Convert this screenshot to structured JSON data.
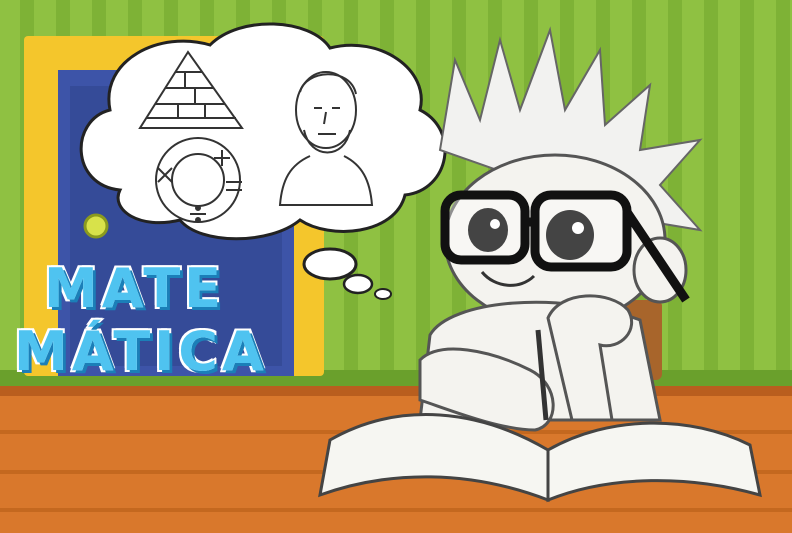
{
  "title": {
    "line1": "MATE",
    "line2": "MÁTICA"
  },
  "thought_bubble": {
    "items": [
      "pyramid-sketch",
      "math-symbols-circle",
      "bust-of-philosopher"
    ]
  },
  "colors": {
    "wall_green": "#8fc142",
    "wall_stripe": "#7eb236",
    "floor_wood": "#d9782c",
    "door_blue": "#3d54a8",
    "door_frame": "#f4c62c",
    "title_blue": "#4fc3f0",
    "title_outline": "#ffffff"
  }
}
